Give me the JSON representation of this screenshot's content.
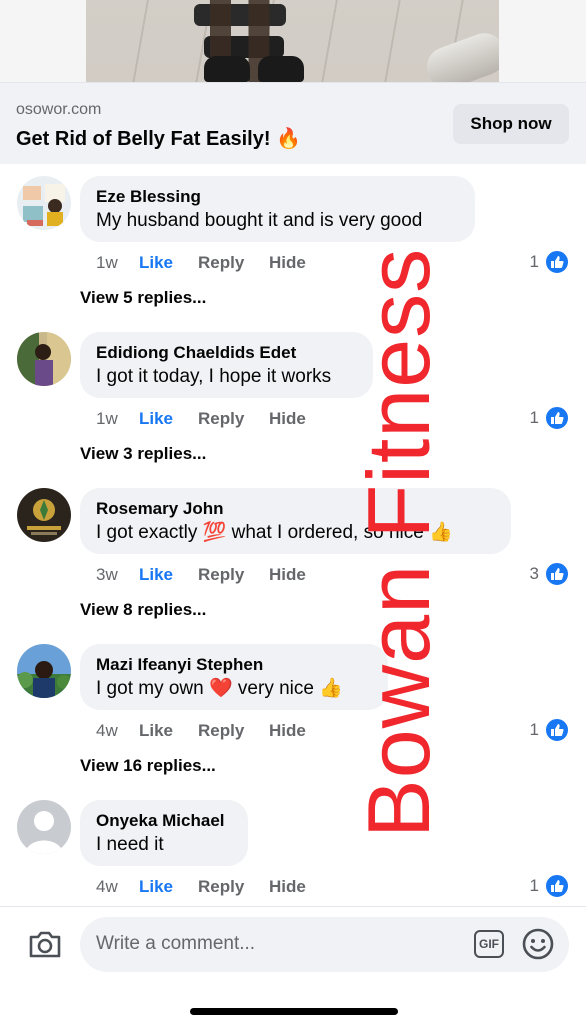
{
  "ad": {
    "domain": "osowor.com",
    "title": "Get Rid of Belly Fat Easily! 🔥",
    "button": "Shop now"
  },
  "comments": [
    {
      "author": "Eze Blessing",
      "text": "My husband bought it and is very good",
      "time": "1w",
      "like": "Like",
      "liked": true,
      "reply": "Reply",
      "hide": "Hide",
      "reaction_count": "1",
      "view_replies": "View 5 replies..."
    },
    {
      "author": "Edidiong Chaeldids Edet",
      "text": "I got it today, I hope it works",
      "time": "1w",
      "like": "Like",
      "liked": true,
      "reply": "Reply",
      "hide": "Hide",
      "reaction_count": "1",
      "view_replies": "View 3 replies..."
    },
    {
      "author": "Rosemary John",
      "text": "I got exactly 💯 what I ordered, so nice 👍",
      "time": "3w",
      "like": "Like",
      "liked": true,
      "reply": "Reply",
      "hide": "Hide",
      "reaction_count": "3",
      "view_replies": "View 8 replies..."
    },
    {
      "author": "Mazi Ifeanyi Stephen",
      "text": "I got my own ❤️ very nice 👍",
      "time": "4w",
      "like": "Like",
      "liked": false,
      "reply": "Reply",
      "hide": "Hide",
      "reaction_count": "1",
      "view_replies": "View 16 replies..."
    },
    {
      "author": "Onyeka Michael",
      "text": "I need it",
      "time": "4w",
      "like": "Like",
      "liked": true,
      "reply": "Reply",
      "hide": "Hide",
      "reaction_count": "1",
      "view_replies": ""
    }
  ],
  "composer": {
    "placeholder": "Write a comment...",
    "gif_label": "GIF",
    "icons": [
      "camera-icon",
      "gif-icon",
      "emoji-icon"
    ]
  },
  "watermark": "Bowan Fitness",
  "colors": {
    "accent": "#1877f2",
    "watermark": "#f0282e",
    "bubble": "#f0f2f5",
    "secondary_text": "#65676b"
  }
}
